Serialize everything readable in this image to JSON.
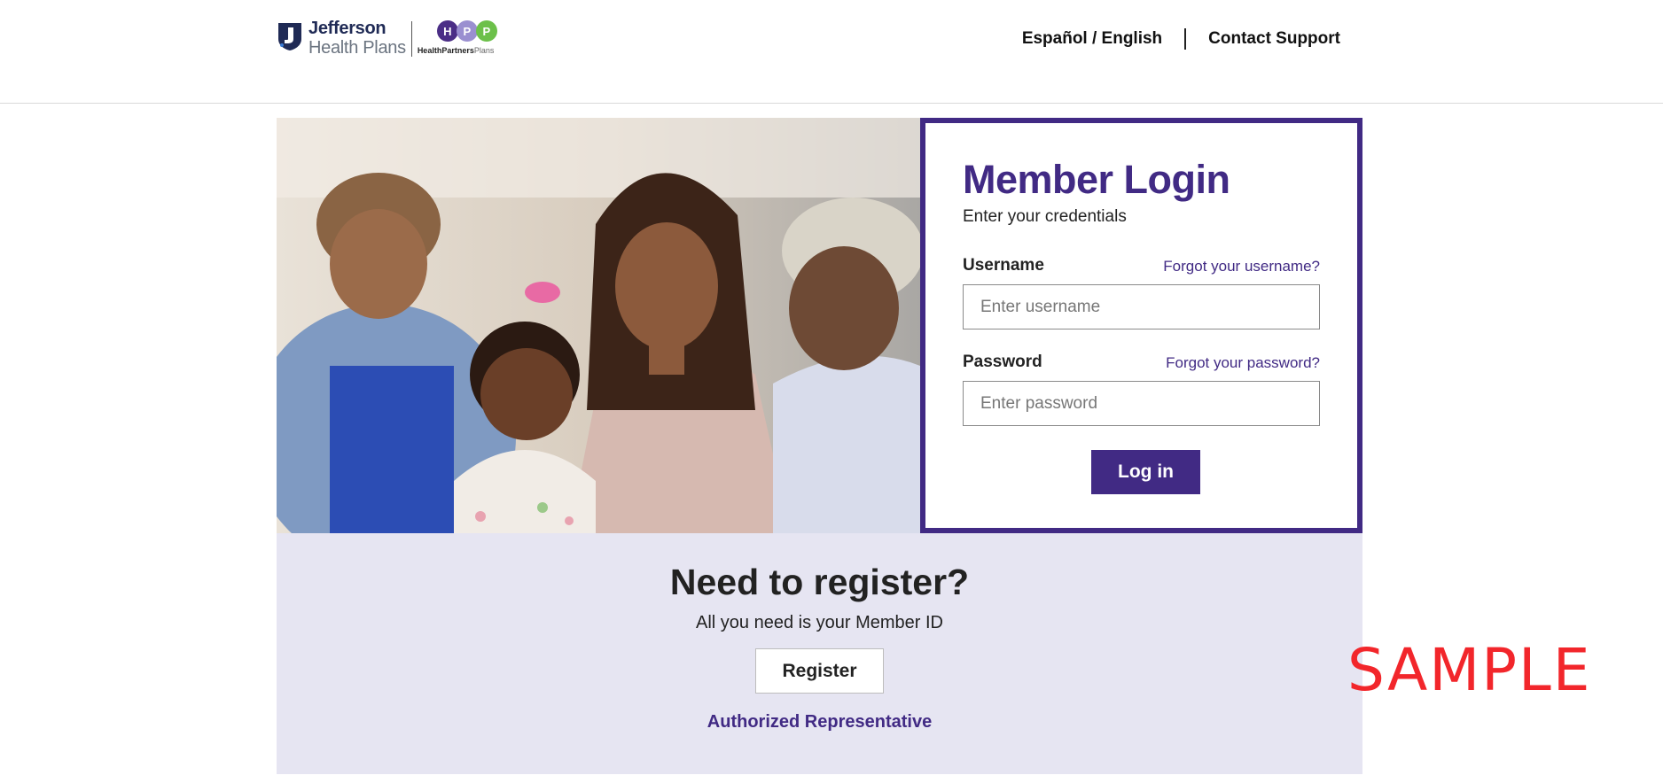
{
  "header": {
    "logo_jefferson_line1": "Jefferson",
    "logo_jefferson_line2": "Health Plans",
    "logo_hpp_letters": [
      "H",
      "P",
      "P"
    ],
    "logo_hpp_tag_bold": "HealthPartners",
    "logo_hpp_tag_light": "Plans",
    "language_toggle": "Español / English",
    "contact_support": "Contact Support"
  },
  "hero": {
    "image": "family-photo"
  },
  "login": {
    "title": "Member Login",
    "subtitle": "Enter your credentials",
    "username_label": "Username",
    "forgot_username": "Forgot your username?",
    "username_placeholder": "Enter username",
    "username_value": "",
    "password_label": "Password",
    "forgot_password": "Forgot your password?",
    "password_placeholder": "Enter password",
    "password_value": "",
    "submit_label": "Log in"
  },
  "register": {
    "title": "Need to register?",
    "subtitle": "All you need is your Member ID",
    "button_label": "Register",
    "authorized_rep": "Authorized Representative"
  },
  "watermark": "SAMPLE",
  "colors": {
    "brand_purple": "#412a84",
    "register_band": "#e6e5f2",
    "hpp_purple_dark": "#4b2e86",
    "hpp_purple_light": "#9a8fd0",
    "hpp_green": "#6cc04a",
    "jefferson_navy": "#1f2a55",
    "watermark_red": "#f2262b"
  },
  "icons": {
    "jefferson_logo": "jefferson-shield-icon",
    "hpp_logo": "hpp-circles-icon"
  }
}
